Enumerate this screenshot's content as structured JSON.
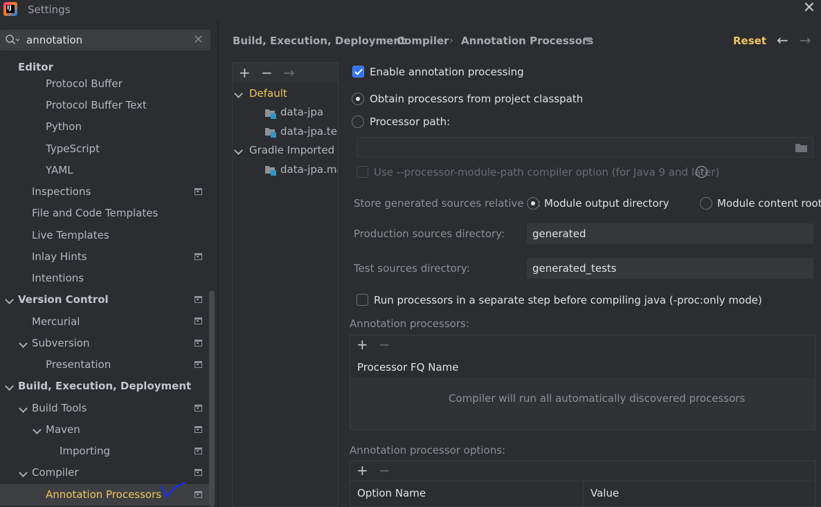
{
  "window": {
    "title": "Settings",
    "close_icon": "close-icon"
  },
  "search": {
    "value": "annotation",
    "icon": "search-icon"
  },
  "sidebar": {
    "items": [
      {
        "label": "Editor",
        "bold": true
      },
      {
        "label": "Protocol Buffer"
      },
      {
        "label": "Protocol Buffer Text"
      },
      {
        "label": "Python"
      },
      {
        "label": "TypeScript"
      },
      {
        "label": "YAML"
      },
      {
        "label": "Inspections"
      },
      {
        "label": "File and Code Templates"
      },
      {
        "label": "Live Templates"
      },
      {
        "label": "Inlay Hints"
      },
      {
        "label": "Intentions"
      },
      {
        "label": "Version Control",
        "bold": true
      },
      {
        "label": "Mercurial"
      },
      {
        "label": "Subversion"
      },
      {
        "label": "Presentation"
      },
      {
        "label": "Build, Execution, Deployment",
        "bold": true
      },
      {
        "label": "Build Tools"
      },
      {
        "label": "Maven"
      },
      {
        "label": "Importing"
      },
      {
        "label": "Compiler"
      },
      {
        "label": "Annotation Processors",
        "selected": true
      }
    ]
  },
  "breadcrumb": [
    "Build, Execution, Deployment",
    "Compiler",
    "Annotation Processors"
  ],
  "header": {
    "reset": "Reset"
  },
  "profiles": {
    "items": [
      {
        "label": "Default",
        "selected": true
      },
      {
        "label": "data-jpa"
      },
      {
        "label": "data-jpa.test"
      },
      {
        "label": "Gradle Imported"
      },
      {
        "label": "data-jpa.main"
      }
    ]
  },
  "form": {
    "enable_label": "Enable annotation processing",
    "enable_checked": true,
    "obtain_label": "Obtain processors from project classpath",
    "processor_path_label": "Processor path:",
    "module_path_label": "Use --processor-module-path compiler option (for Java 9 and later)",
    "store_label": "Store generated sources relative to:",
    "module_output_label": "Module output directory",
    "module_content_label": "Module content root",
    "production_label": "Production sources directory:",
    "production_value": "generated",
    "test_label": "Test sources directory:",
    "test_value": "generated_tests",
    "separate_step_label": "Run processors in a separate step before compiling java (-proc:only mode)"
  },
  "processors_panel": {
    "title": "Annotation processors:",
    "column": "Processor FQ Name",
    "empty_text": "Compiler will run all automatically discovered processors"
  },
  "options_panel": {
    "title": "Annotation processor options:",
    "columns": [
      "Option Name",
      "Value"
    ]
  },
  "colors": {
    "accent": "#3574f0",
    "highlight": "#f2c55c",
    "annotation": "#1b2bf0"
  }
}
